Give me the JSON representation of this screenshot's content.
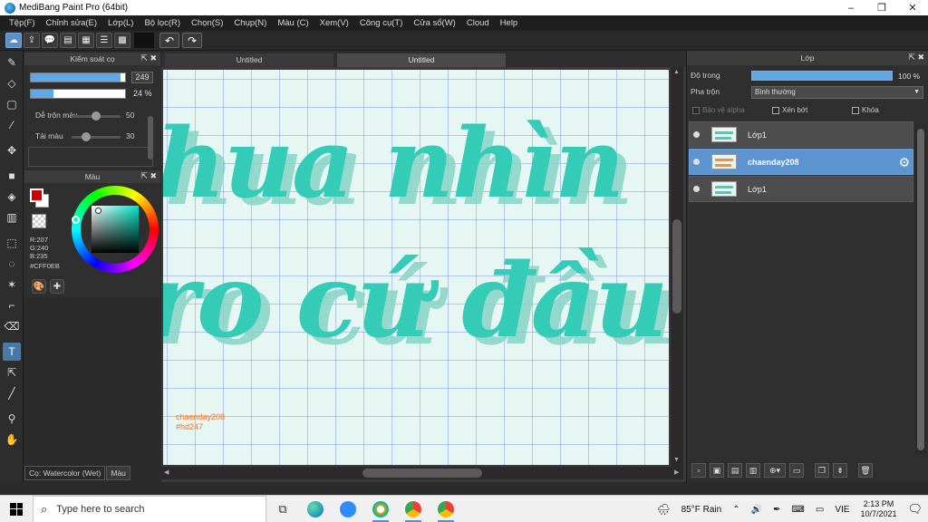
{
  "window": {
    "title": "MediBang Paint Pro (64bit)",
    "controls": [
      "–",
      "❐",
      "✕"
    ]
  },
  "menu": [
    "Tệp(F)",
    "Chỉnh sửa(E)",
    "Lớp(L)",
    "Bộ lọc(R)",
    "Chọn(S)",
    "Chụp(N)",
    "Màu (C)",
    "Xem(V)",
    "Công cụ(T)",
    "Cửa sổ(W)",
    "Cloud",
    "Help"
  ],
  "brush_panel": {
    "title": "Kiểm soát cọ",
    "size_value": "249",
    "size_fraction": 0.95,
    "opacity_value": "24 %",
    "opacity_fraction": 0.24,
    "blend_label": "Dễ trộn màu",
    "blend_value": "50",
    "amount_label": "Tải màu",
    "amount_value": "30"
  },
  "color_panel": {
    "title": "Màu",
    "foreground_color": "#cf0000",
    "r": "R:207",
    "g": "G:240",
    "b": "B:235",
    "hex": "#CFF0EB"
  },
  "left_tabs": [
    "Cọ: Watercolor (Wet)",
    "Màu"
  ],
  "documents": [
    "Untitled",
    "Untitled"
  ],
  "canvas": {
    "line1": "hua nhìn",
    "line2": "ro cứ đầu",
    "watermark1": "chaenday208",
    "watermark2": "#hd247"
  },
  "layer_panel": {
    "title": "Lớp",
    "opacity_label": "Độ trong",
    "opacity_value": "100 %",
    "blend_label": "Pha trộn",
    "blend_value": "Bình thường",
    "alpha_label": "Bảo vệ alpha",
    "clip_label": "Xén bớt",
    "lock_label": "Khóa",
    "layers": [
      {
        "name": "Lớp1",
        "active": false
      },
      {
        "name": "chaenday208",
        "active": true
      },
      {
        "name": "Lớp1",
        "active": false
      }
    ]
  },
  "taskbar": {
    "search_placeholder": "Type here to search",
    "weather": "85°F  Rain",
    "language": "VIE",
    "time": "2:13 PM",
    "date": "10/7/2021"
  }
}
